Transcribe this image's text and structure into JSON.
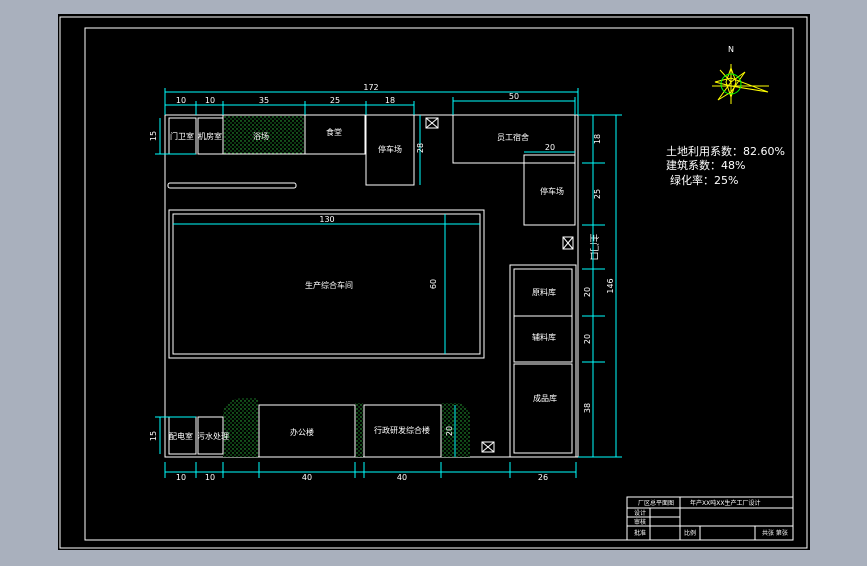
{
  "colors": {
    "background_outer": "#a9b0bd",
    "canvas": "#000000",
    "border": "#ffffff",
    "dimension": "#00ffff",
    "green": "#00ff00",
    "compass": "#ffff00"
  },
  "compass": {
    "north_label": "N"
  },
  "stats": {
    "land_use": "土地利用系数：82.60%",
    "building": "建筑系数：48%",
    "greening": "绿化率：25%"
  },
  "dimensions": {
    "top_total": "172",
    "top_row": [
      "10",
      "10",
      "35",
      "25",
      "18"
    ],
    "dorm_width": "50",
    "garage_width": "20",
    "workshop_width": "130",
    "workshop_height": "60",
    "left_top_height": "15",
    "parking_height": "28",
    "left_bottom_height": "15",
    "office_height": "20",
    "right_col": [
      "18",
      "25",
      "20",
      "20",
      "38"
    ],
    "total_height": "146",
    "bottom_row": [
      "10",
      "10",
      "40",
      "40",
      "26"
    ]
  },
  "rooms": {
    "guard_room": "门卫室",
    "machine_room": "机房室",
    "bath": "浴场",
    "canteen": "食堂",
    "parking": "停车场",
    "dormitory": "员工宿舍",
    "garage_right": "停车场",
    "workshop": "生产综合车间",
    "raw_storage": "原料库",
    "aux_storage": "辅料库",
    "product_storage": "成品库",
    "power_room": "配电室",
    "waste_room": "污水处理",
    "office": "办公楼",
    "admin_rd": "行政研发综合楼",
    "main_entrance": "主门口"
  },
  "title_block": {
    "company": "厂区总平面图",
    "project": "年产XX吨XX生产工厂设计",
    "designer": "设计",
    "checker": "审核",
    "approver": "批准",
    "scale": "比例",
    "sheet": "共张 第张"
  }
}
